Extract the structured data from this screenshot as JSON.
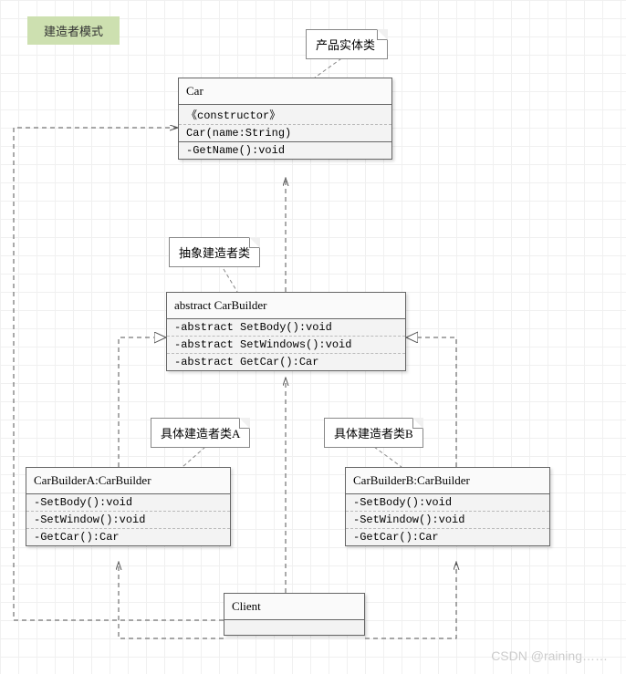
{
  "title": "建造者模式",
  "notes": {
    "product": "产品实体类",
    "abstract_builder": "抽象建造者类",
    "builder_a": "具体建造者类A",
    "builder_b": "具体建造者类B"
  },
  "classes": {
    "car": {
      "name": "Car",
      "stereotype": "《constructor》",
      "ctor": "Car(name:String)",
      "methods": [
        "-GetName():void"
      ]
    },
    "car_builder": {
      "name": "abstract CarBuilder",
      "methods": [
        "-abstract SetBody():void",
        "-abstract SetWindows():void",
        "-abstract GetCar():Car"
      ]
    },
    "builder_a": {
      "name": "CarBuilderA:CarBuilder",
      "methods": [
        "-SetBody():void",
        "-SetWindow():void",
        "-GetCar():Car"
      ]
    },
    "builder_b": {
      "name": "CarBuilderB:CarBuilder",
      "methods": [
        "-SetBody():void",
        "-SetWindow():void",
        "-GetCar():Car"
      ]
    },
    "client": {
      "name": "Client"
    }
  },
  "watermark": "CSDN @raining……"
}
